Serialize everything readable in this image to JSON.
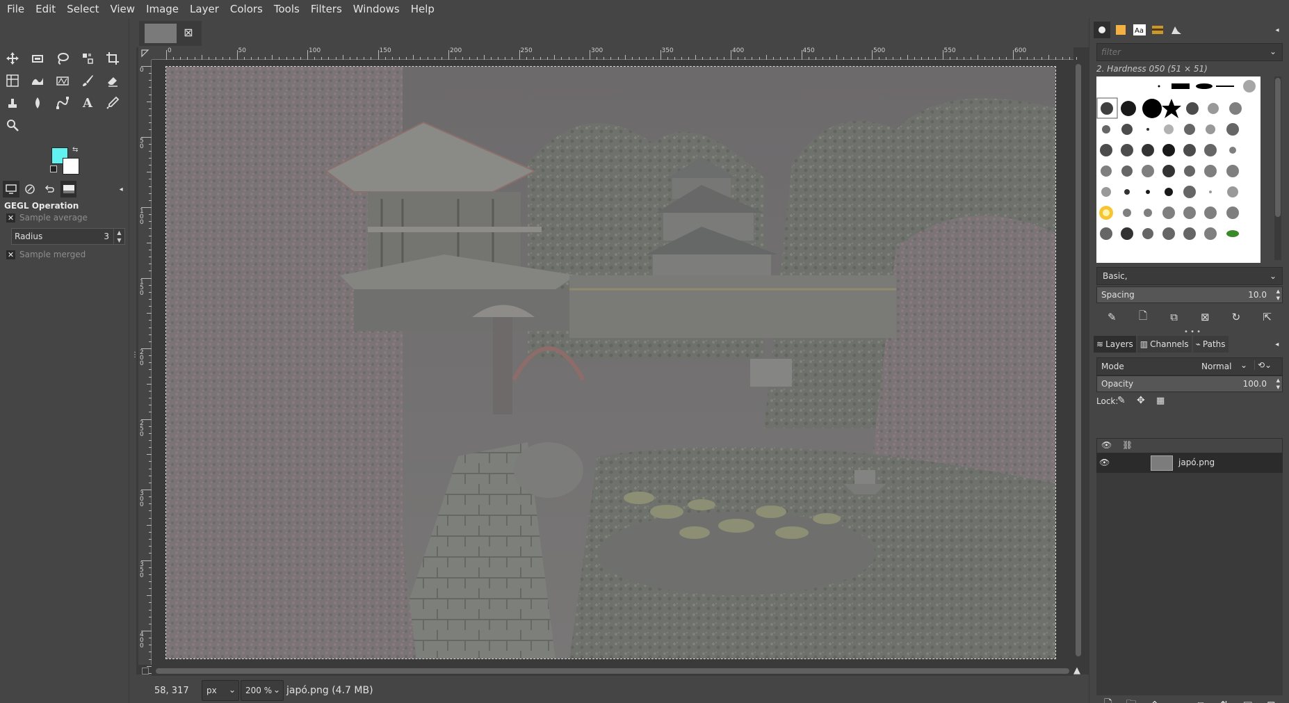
{
  "menu": [
    "File",
    "Edit",
    "Select",
    "View",
    "Image",
    "Layer",
    "Colors",
    "Tools",
    "Filters",
    "Windows",
    "Help"
  ],
  "colors": {
    "foreground": "#5ff2f0",
    "background": "#ffffff"
  },
  "tool_options": {
    "title": "GEGL Operation",
    "sample_average_label": "Sample average",
    "radius_label": "Radius",
    "radius_value": "3",
    "sample_merged_label": "Sample merged"
  },
  "ruler": {
    "h_labels": [
      "0",
      "50",
      "100",
      "150",
      "200",
      "250",
      "300",
      "350",
      "400",
      "450",
      "500",
      "550",
      "600"
    ],
    "v_labels": [
      "0",
      "50",
      "100",
      "150",
      "200",
      "250",
      "300",
      "350",
      "400"
    ]
  },
  "status": {
    "coords": "58, 317",
    "unit": "px",
    "zoom": "200 %",
    "file_info": "japó.png (4.7 MB)"
  },
  "brushes": {
    "filter_placeholder": "filter",
    "selected_name": "2. Hardness 050 (51 × 51)",
    "brush_set": "Basic,",
    "spacing_label": "Spacing",
    "spacing_value": "10.0"
  },
  "layers": {
    "tabs": [
      "Layers",
      "Channels",
      "Paths"
    ],
    "mode_label": "Mode",
    "mode_value": "Normal",
    "opacity_label": "Opacity",
    "opacity_value": "100.0",
    "lock_label": "Lock:",
    "items": [
      {
        "name": "japó.png",
        "visible": true
      }
    ]
  }
}
